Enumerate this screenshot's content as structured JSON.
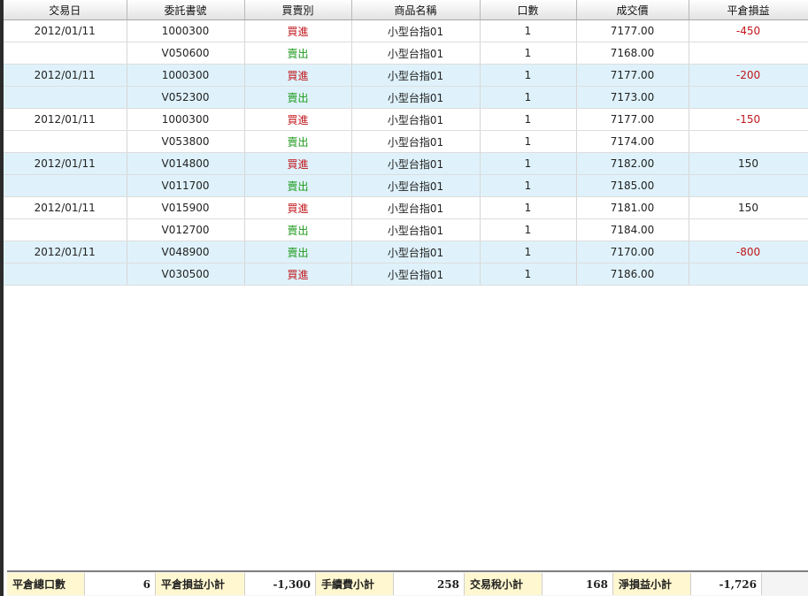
{
  "columns": [
    "交易日",
    "委託書號",
    "買賣別",
    "商品名稱",
    "口數",
    "成交價",
    "平倉損益"
  ],
  "rows": [
    {
      "date": "2012/01/11",
      "order": "1000300",
      "side": "買進",
      "side_type": "buy",
      "product": "小型台指01",
      "qty": "1",
      "price": "7177.00",
      "pnl": "-450",
      "pnl_type": "neg",
      "band": "white"
    },
    {
      "date": "",
      "order": "V050600",
      "side": "賣出",
      "side_type": "sell",
      "product": "小型台指01",
      "qty": "1",
      "price": "7168.00",
      "pnl": "",
      "pnl_type": "pos",
      "band": "white"
    },
    {
      "date": "2012/01/11",
      "order": "1000300",
      "side": "買進",
      "side_type": "buy",
      "product": "小型台指01",
      "qty": "1",
      "price": "7177.00",
      "pnl": "-200",
      "pnl_type": "neg",
      "band": "blue"
    },
    {
      "date": "",
      "order": "V052300",
      "side": "賣出",
      "side_type": "sell",
      "product": "小型台指01",
      "qty": "1",
      "price": "7173.00",
      "pnl": "",
      "pnl_type": "pos",
      "band": "blue"
    },
    {
      "date": "2012/01/11",
      "order": "1000300",
      "side": "買進",
      "side_type": "buy",
      "product": "小型台指01",
      "qty": "1",
      "price": "7177.00",
      "pnl": "-150",
      "pnl_type": "neg",
      "band": "white"
    },
    {
      "date": "",
      "order": "V053800",
      "side": "賣出",
      "side_type": "sell",
      "product": "小型台指01",
      "qty": "1",
      "price": "7174.00",
      "pnl": "",
      "pnl_type": "pos",
      "band": "white"
    },
    {
      "date": "2012/01/11",
      "order": "V014800",
      "side": "買進",
      "side_type": "buy",
      "product": "小型台指01",
      "qty": "1",
      "price": "7182.00",
      "pnl": "150",
      "pnl_type": "pos",
      "band": "blue"
    },
    {
      "date": "",
      "order": "V011700",
      "side": "賣出",
      "side_type": "sell",
      "product": "小型台指01",
      "qty": "1",
      "price": "7185.00",
      "pnl": "",
      "pnl_type": "pos",
      "band": "blue"
    },
    {
      "date": "2012/01/11",
      "order": "V015900",
      "side": "買進",
      "side_type": "buy",
      "product": "小型台指01",
      "qty": "1",
      "price": "7181.00",
      "pnl": "150",
      "pnl_type": "pos",
      "band": "white"
    },
    {
      "date": "",
      "order": "V012700",
      "side": "賣出",
      "side_type": "sell",
      "product": "小型台指01",
      "qty": "1",
      "price": "7184.00",
      "pnl": "",
      "pnl_type": "pos",
      "band": "white"
    },
    {
      "date": "2012/01/11",
      "order": "V048900",
      "side": "賣出",
      "side_type": "sell",
      "product": "小型台指01",
      "qty": "1",
      "price": "7170.00",
      "pnl": "-800",
      "pnl_type": "neg",
      "band": "blue"
    },
    {
      "date": "",
      "order": "V030500",
      "side": "買進",
      "side_type": "buy",
      "product": "小型台指01",
      "qty": "1",
      "price": "7186.00",
      "pnl": "",
      "pnl_type": "pos",
      "band": "blue"
    }
  ],
  "summary": {
    "total_lots_label": "平倉總口數",
    "total_lots": "6",
    "pnl_subtotal_label": "平倉損益小計",
    "pnl_subtotal": "-1,300",
    "fee_subtotal_label": "手續費小計",
    "fee_subtotal": "258",
    "tax_subtotal_label": "交易稅小計",
    "tax_subtotal": "168",
    "net_pnl_label": "淨損益小計",
    "net_pnl": "-1,726"
  },
  "colors": {
    "buy": "#c0161b",
    "sell": "#1d9a1d",
    "band": "#dff2fb",
    "label_bg": "#fff7cf"
  }
}
